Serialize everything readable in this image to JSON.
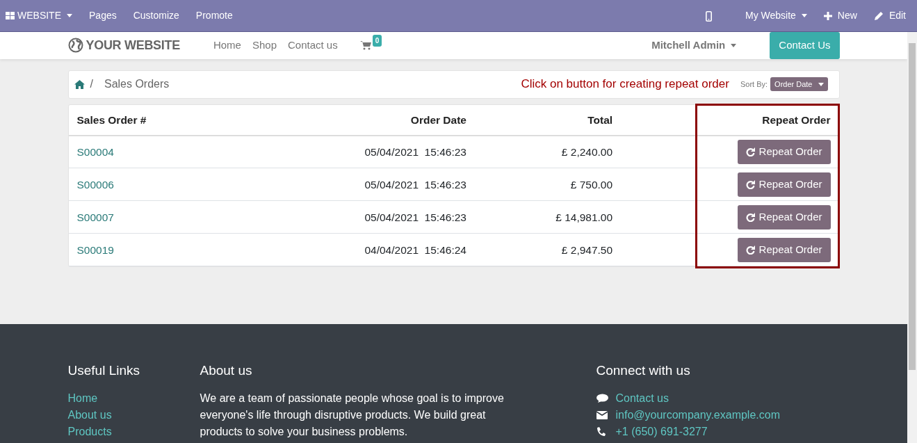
{
  "admin_bar": {
    "app_menu": "WEBSITE",
    "items": [
      "Pages",
      "Customize",
      "Promote"
    ],
    "website_menu": "My Website",
    "new_label": "New",
    "edit_label": "Edit"
  },
  "header": {
    "logo": "YOUR WEBSITE",
    "nav": [
      "Home",
      "Shop",
      "Contact us"
    ],
    "cart_count": "0",
    "user": "Mitchell Admin",
    "cta": "Contact Us"
  },
  "breadcrumb": {
    "separator": "/",
    "current": "Sales Orders"
  },
  "annotation": "Click on button for creating repeat order",
  "sort": {
    "label": "Sort By:",
    "value": "Order Date"
  },
  "table": {
    "columns": [
      "Sales Order #",
      "Order Date",
      "Total",
      "Repeat Order"
    ],
    "rows": [
      {
        "order": "S00004",
        "date": "05/04/2021  15:46:23",
        "total": "£ 2,240.00",
        "action": "Repeat Order"
      },
      {
        "order": "S00006",
        "date": "05/04/2021  15:46:23",
        "total": "£ 750.00",
        "action": "Repeat Order"
      },
      {
        "order": "S00007",
        "date": "05/04/2021  15:46:23",
        "total": "£ 14,981.00",
        "action": "Repeat Order"
      },
      {
        "order": "S00019",
        "date": "04/04/2021  15:46:24",
        "total": "£ 2,947.50",
        "action": "Repeat Order"
      }
    ]
  },
  "footer": {
    "useful_links": {
      "title": "Useful Links",
      "links": [
        "Home",
        "About us",
        "Products"
      ]
    },
    "about": {
      "title": "About us",
      "text": "We are a team of passionate people whose goal is to improve everyone's life through disruptive products. We build great products to solve your business problems."
    },
    "connect": {
      "title": "Connect with us",
      "items": [
        {
          "kind": "chat",
          "text": "Contact us"
        },
        {
          "kind": "mail",
          "text": "info@yourcompany.example.com"
        },
        {
          "kind": "phone",
          "text": "+1 (650) 691-3277"
        }
      ]
    }
  }
}
